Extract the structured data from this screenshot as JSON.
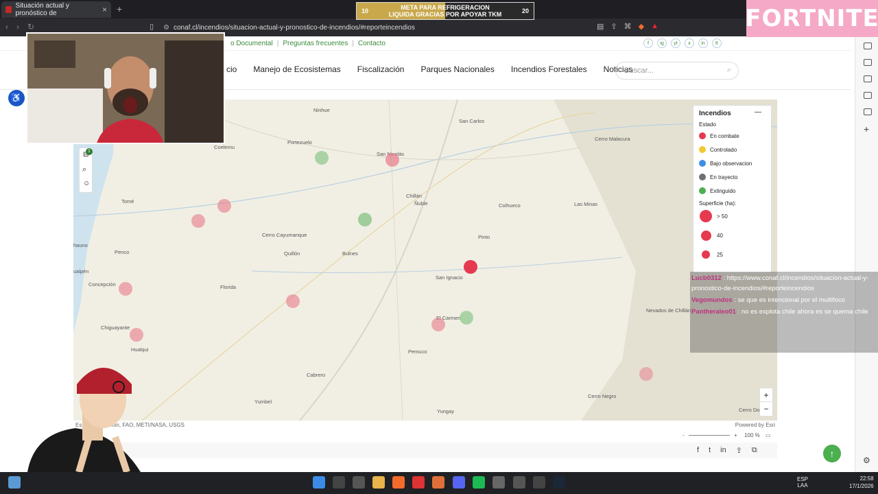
{
  "browser": {
    "tab_title": "Situación actual y pronóstico de",
    "url": "conaf.cl/incendios/situacion-actual-y-pronostico-de-incendios/#reporteincendios",
    "new_tab": "+",
    "tab_close": "×"
  },
  "donation_banner": {
    "current": "10",
    "goal": "20",
    "line1": "META PARA REFRIGERACION",
    "line2": "LIQUIDA GRACIAS POR APOYAR TKM",
    "progress_fraction": 0.5
  },
  "overlay_logo": "FORTNITE",
  "site": {
    "top_links": [
      "o Documental",
      "|",
      "Preguntas frecuentes",
      "|",
      "Contacto"
    ],
    "social": [
      "f",
      "ig",
      "yt",
      "x",
      "in",
      "tt"
    ],
    "nav": [
      "cio",
      "Manejo de Ecosistemas",
      "Fiscalización",
      "Parques Nacionales",
      "Incendios Forestales",
      "Noticias"
    ],
    "search_placeholder": "Buscar..."
  },
  "map": {
    "places": [
      {
        "name": "Ninhue"
      },
      {
        "name": "Portezuelo"
      },
      {
        "name": "San Nicolás"
      },
      {
        "name": "San Carlos"
      },
      {
        "name": "Chillán"
      },
      {
        "name": "Ñuble"
      },
      {
        "name": "Coihueco"
      },
      {
        "name": "Pinto"
      },
      {
        "name": "Quillón"
      },
      {
        "name": "Bulnes"
      },
      {
        "name": "San Ignacio"
      },
      {
        "name": "El Carmen"
      },
      {
        "name": "Pemuco"
      },
      {
        "name": "Florida"
      },
      {
        "name": "Concepción"
      },
      {
        "name": "Chiguayante"
      },
      {
        "name": "Hualqui"
      },
      {
        "name": "Cabrero"
      },
      {
        "name": "Yumbel"
      },
      {
        "name": "Yungay"
      },
      {
        "name": "Tomé"
      },
      {
        "name": "Penco"
      },
      {
        "name": "Coelemu"
      },
      {
        "name": "Cerro Cayumanque"
      },
      {
        "name": "Cerro Malacura"
      },
      {
        "name": "Las Minas"
      },
      {
        "name": "Nevados de Chillán"
      },
      {
        "name": "Cerro Negro"
      },
      {
        "name": "Cerro Donaire"
      },
      {
        "name": "hauno"
      },
      {
        "name": "ualpén"
      }
    ],
    "attribution_left": "Es... Tom, Garmin, FAO, METI/NASA, USGS",
    "attribution_right": "Powered by Esri",
    "zoom_in": "+",
    "zoom_out": "−",
    "zoom_level": "100 %",
    "tool_badge": "1"
  },
  "legend": {
    "title": "Incendios",
    "estado_label": "Estado",
    "estados": [
      {
        "label": "En combate",
        "color": "#e53950"
      },
      {
        "label": "Controlado",
        "color": "#f2c935"
      },
      {
        "label": "Bajo observacion",
        "color": "#3d8ee6"
      },
      {
        "label": "En trayecto",
        "color": "#6f6f6f"
      },
      {
        "label": "Extinguido",
        "color": "#4caf50"
      }
    ],
    "superficie_label": "Superficie (ha):",
    "superficies": [
      "> 50",
      "40",
      "25"
    ]
  },
  "chat": [
    {
      "user": "Lucb0312",
      "text": ": https://www.conaf.cl/incendios/situacion-actual-y-pronostico-de-incendios/#reporteincendios"
    },
    {
      "user": "Vegomundos",
      "text": ": se que es intencional por el multifoco"
    },
    {
      "user": "Pantheraleo01",
      "text": ": no es explota chile ahora es se quema chile"
    }
  ],
  "taskbar": {
    "lang1": "ESP",
    "lang2": "LAA",
    "time": "22:58",
    "date": "17/1/2026"
  }
}
